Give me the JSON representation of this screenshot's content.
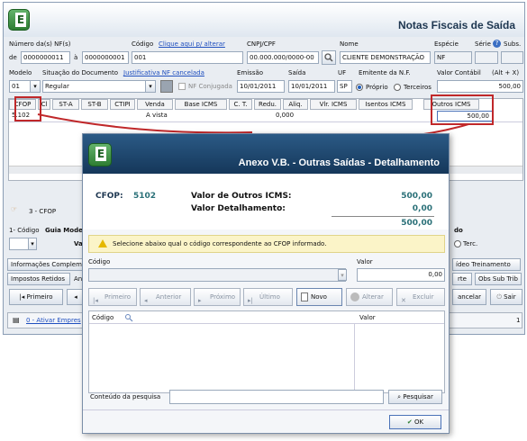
{
  "window": {
    "title": "Notas Fiscais de Saída"
  },
  "row1": {
    "numero_label": "Número da(s) NF(s)",
    "de": "de",
    "num_start": "0000000011",
    "a": "à",
    "num_end": "0000000001",
    "codigo_label": "Código",
    "codigo_link": "Clique aqui p/ alterar",
    "codigo_value": "001",
    "cnpj_label": "CNPJ/CPF",
    "cnpj_value": "00.000.000/0000-00",
    "nome_label": "Nome",
    "nome_value": "CLIENTE DEMONSTRAÇÃO",
    "especie_label": "Espécie",
    "especie_value": "NF",
    "serie_label": "Série",
    "subs_label": "Subs."
  },
  "row2": {
    "modelo_label": "Modelo",
    "modelo_value": "01",
    "situacao_label": "Situação do Documento",
    "situacao_link": "Justificativa NF cancelada",
    "situacao_value": "Regular",
    "nf_conjugada": "NF Conjugada",
    "emissao_label": "Emissão",
    "emissao_value": "10/01/2011",
    "saida_label": "Saída",
    "saida_value": "10/01/2011",
    "uf_label": "UF",
    "uf_value": "SP",
    "emitente_label": "Emitente da N.F.",
    "proprio": "Próprio",
    "terceiros": "Terceiros",
    "contabil_label": "Valor Contábil",
    "contabil_hint": "(Alt + X)",
    "contabil_value": "500,00"
  },
  "grid": {
    "headers": [
      "CFOP",
      "Cl",
      "ST-A",
      "ST-B",
      "CTIPI",
      "Venda",
      "Base ICMS",
      "C. T.",
      "Redu.",
      "Aliq.",
      "Vlr. ICMS",
      "Isentos ICMS",
      "Outros ICMS"
    ],
    "row": {
      "cfop": "5.102",
      "venda": "A vista",
      "redu": "0,000",
      "outros": "500,00"
    }
  },
  "lower": {
    "cfop_item": "3 - CFOP",
    "codigo_label": "1- Código",
    "guia_label": "Guia Model",
    "va_label": "Va",
    "info_tab": "Informações Complem",
    "impostos_tab": "Impostos Retidos",
    "an_label": "An",
    "primeiro": "Primeiro",
    "ativar": "0 - Ativar Empres",
    "do_label": "do",
    "terc_label": "Terc.",
    "video_btn": "ídeo Treinamento",
    "rte": "rte",
    "obs_btn": "Obs Sub Trib",
    "cancelar_btn": "ancelar",
    "sair_btn": "Sair",
    "page_num": "1"
  },
  "dialog": {
    "title": "Anexo V.B. - Outras Saídas - Detalhamento",
    "cfop_label": "CFOP:",
    "cfop_value": "5102",
    "outros_label": "Valor de Outros ICMS:",
    "outros_value": "500,00",
    "detal_label": "Valor Detalhamento:",
    "detal_value": "0,00",
    "total_value": "500,00",
    "warning": "Selecione abaixo qual o código correspondente ao CFOP informado.",
    "codigo_label": "Código",
    "valor_label": "Valor",
    "valor_value": "0,00",
    "buttons": [
      "Primeiro",
      "Anterior",
      "Próximo",
      "Último",
      "Novo",
      "Alterar",
      "Excluir"
    ],
    "list_headers": {
      "codigo": "Código",
      "valor": "Valor"
    },
    "search_label": "Conteúdo da pesquisa",
    "search_btn": "Pesquisar",
    "ok_btn": "OK"
  },
  "colors": {
    "accent": "#1d3650",
    "highlight": "#c0282a",
    "teal": "#2a7078"
  }
}
